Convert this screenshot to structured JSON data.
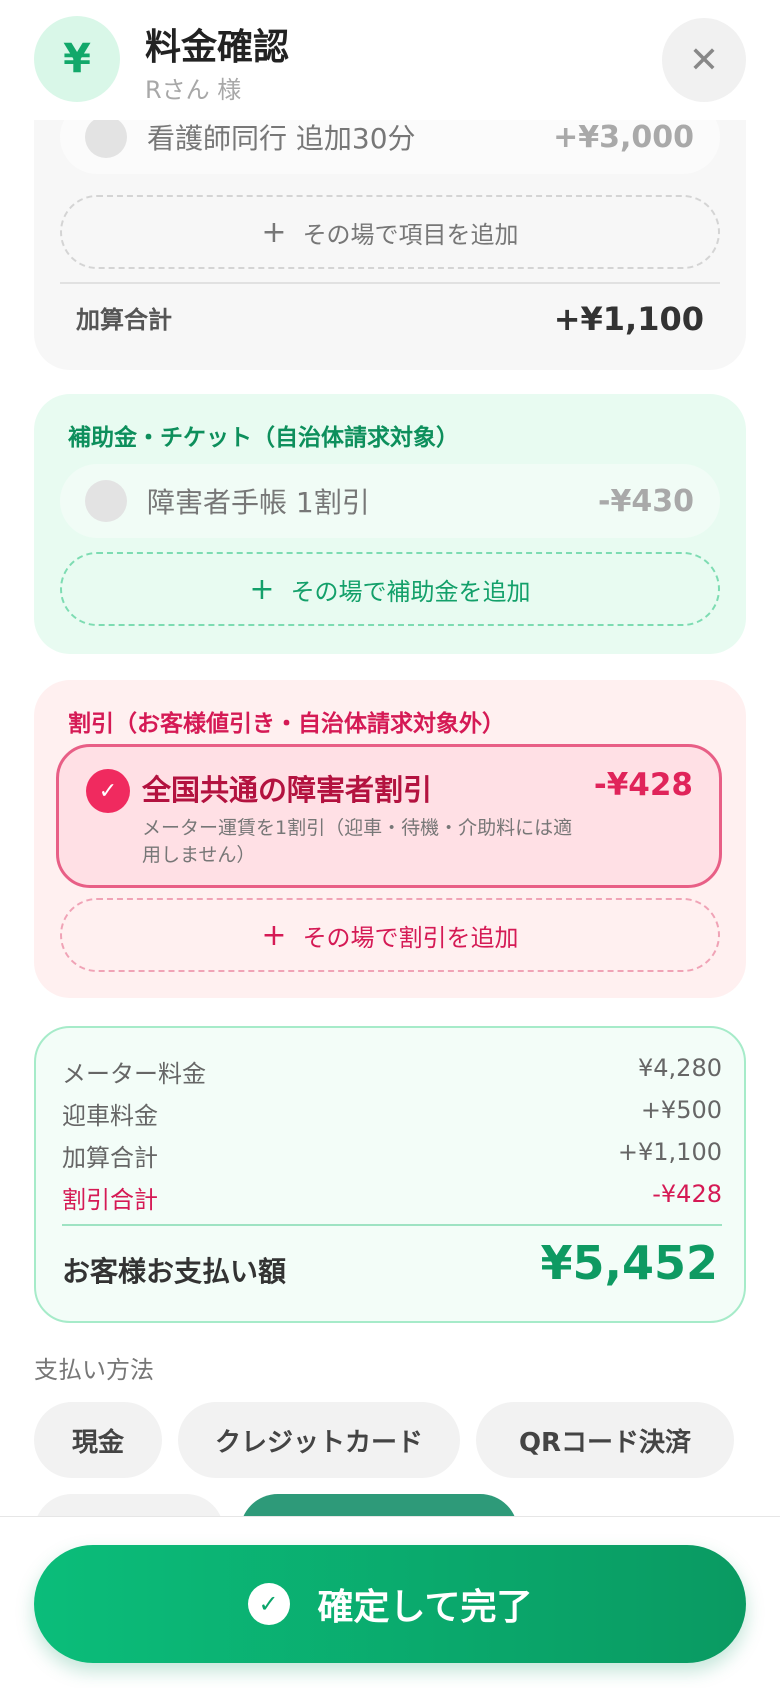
{
  "header": {
    "icon": "yen-icon",
    "icon_glyph": "¥",
    "title": "料金確認",
    "subtitle": "Rさん 様",
    "close_glyph": "✕"
  },
  "surcharge": {
    "items": [
      {
        "label": "看護師同行 追加30分",
        "amount": "+¥3,000",
        "selected": false
      }
    ],
    "add_label": "その場で項目を追加",
    "total_label": "加算合計",
    "total_value": "+¥1,100"
  },
  "subsidy": {
    "title": "補助金・チケット（自治体請求対象）",
    "items": [
      {
        "label": "障害者手帳 1割引",
        "amount": "-¥430",
        "selected": false
      }
    ],
    "add_label": "その場で補助金を追加"
  },
  "discount": {
    "title": "割引（お客様値引き・自治体請求対象外）",
    "items": [
      {
        "label": "全国共通の障害者割引",
        "amount": "-¥428",
        "description": "メーター運賃を1割引（迎車・待機・介助料には適用しません）",
        "selected": true
      }
    ],
    "add_label": "その場で割引を追加"
  },
  "totals": {
    "rows": [
      {
        "label": "メーター料金",
        "value": "¥4,280"
      },
      {
        "label": "迎車料金",
        "value": "+¥500"
      },
      {
        "label": "加算合計",
        "value": "+¥1,100"
      },
      {
        "label": "割引合計",
        "value": "-¥428"
      }
    ],
    "total_label": "お客様お支払い額",
    "total_value": "¥5,452"
  },
  "payment": {
    "label": "支払い方法",
    "methods": [
      "現金",
      "クレジットカード",
      "QRコード決済"
    ]
  },
  "confirm": {
    "label": "確定して完了",
    "check_glyph": "✓"
  },
  "colors": {
    "accent_green": "#0bbd7a",
    "discount_pink": "#d51a55",
    "subsidy_green": "#0d8f5c"
  }
}
